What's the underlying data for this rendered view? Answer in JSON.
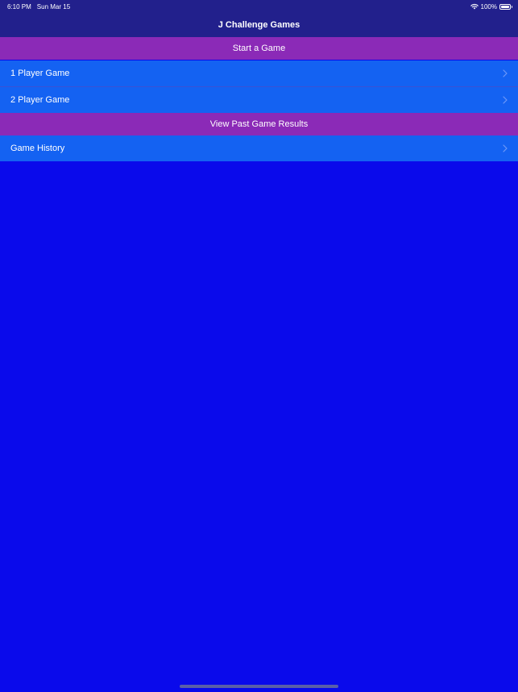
{
  "status_bar": {
    "time": "6:10 PM",
    "date": "Sun Mar 15",
    "battery_text": "100%",
    "wifi_icon": "wifi-icon",
    "battery_icon": "battery-icon"
  },
  "nav": {
    "title": "J Challenge Games"
  },
  "sections": [
    {
      "header": "Start a Game",
      "items": [
        {
          "label": "1 Player Game",
          "icon": "chevron-right-icon"
        },
        {
          "label": "2 Player Game",
          "icon": "chevron-right-icon"
        }
      ]
    },
    {
      "header": "View Past Game Results",
      "items": [
        {
          "label": "Game History",
          "icon": "chevron-right-icon"
        }
      ]
    }
  ],
  "colors": {
    "background": "#0a0aeb",
    "nav_background": "#22208c",
    "section_header": "#8b2ab7",
    "row_background": "#1462f2"
  }
}
